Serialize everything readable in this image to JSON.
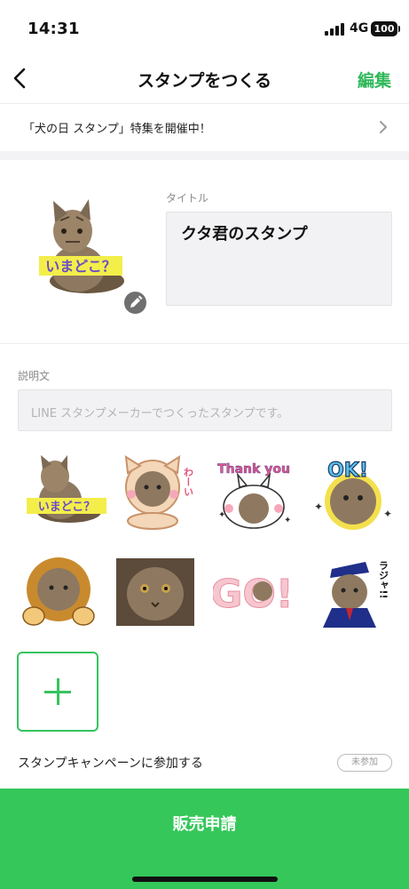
{
  "status": {
    "time": "14:31",
    "network": "4G",
    "battery": "100"
  },
  "nav": {
    "title": "スタンプをつくる",
    "edit": "編集"
  },
  "banner": {
    "text": "「犬の日 スタンプ」特集を開催中！"
  },
  "stamp_set": {
    "title_label": "タイトル",
    "title_value": "クタ君のスタンプ",
    "cover_caption": "いまどこ？"
  },
  "description": {
    "label": "説明文",
    "placeholder": "LINE スタンプメーカーでつくったスタンプです。"
  },
  "stickers": [
    {
      "caption": "いまどこ？"
    },
    {
      "caption": "わーい"
    },
    {
      "caption": "Thank you"
    },
    {
      "caption": "OK!"
    },
    {
      "caption": ""
    },
    {
      "caption": ""
    },
    {
      "caption": "GO!"
    },
    {
      "caption": "ラジャ!!"
    }
  ],
  "campaign": {
    "label": "スタンプキャンペーンに参加する",
    "status": "未参加"
  },
  "sell_button": {
    "label": "販売申請"
  },
  "colors": {
    "accent": "#35c75a",
    "edit_text": "#2fb85a"
  },
  "icons": {
    "back": "chevron-left-icon",
    "chevron": "chevron-right-icon",
    "edit": "pencil-icon",
    "add": "plus-icon"
  }
}
